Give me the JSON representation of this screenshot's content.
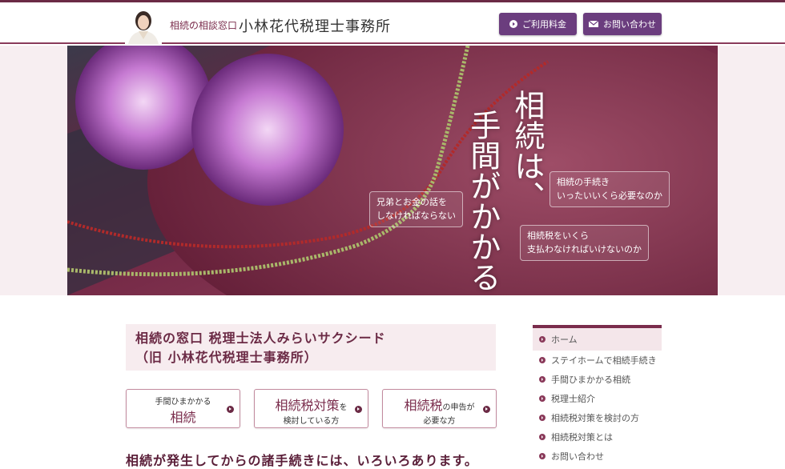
{
  "header": {
    "brand_sub": "相続の相談窓口",
    "brand_main": "小林花代税理士事務所",
    "fees_label": "ご利用料金",
    "contact_label": "お問い合わせ"
  },
  "hero": {
    "title_col1": "相続は、",
    "title_col2": "手間がかかる",
    "bubbles": [
      "兄弟とお金の話を\nしなければならない",
      "相続の手続き\nいったいいくら必要なのか",
      "相続税をいくら\n支払わなければいけないのか"
    ]
  },
  "main": {
    "office_line1": "相続の窓口 税理士法人みらいサクシード",
    "office_line2": "（旧 小林花代税理士事務所）",
    "cards": [
      {
        "small_top": "手間ひまかかる",
        "big": "相続",
        "small_bottom": ""
      },
      {
        "big": "相続税対策",
        "small_inline": "を",
        "small_bottom": "検討している方"
      },
      {
        "big": "相続税",
        "small_inline": "の申告が",
        "small_bottom": "必要な方"
      }
    ],
    "lead": "相続が発生してからの諸手続きには、いろいろあります。"
  },
  "nav": {
    "items": [
      "ホーム",
      "ステイホームで相続手続き",
      "手間ひまかかる相続",
      "税理士紹介",
      "相続税対策を検討の方",
      "相続税対策とは",
      "お問い合わせ"
    ]
  },
  "colors": {
    "accent": "#7a2c4c",
    "button": "#6b3d7e",
    "hero_bg": "#f7eef1"
  }
}
